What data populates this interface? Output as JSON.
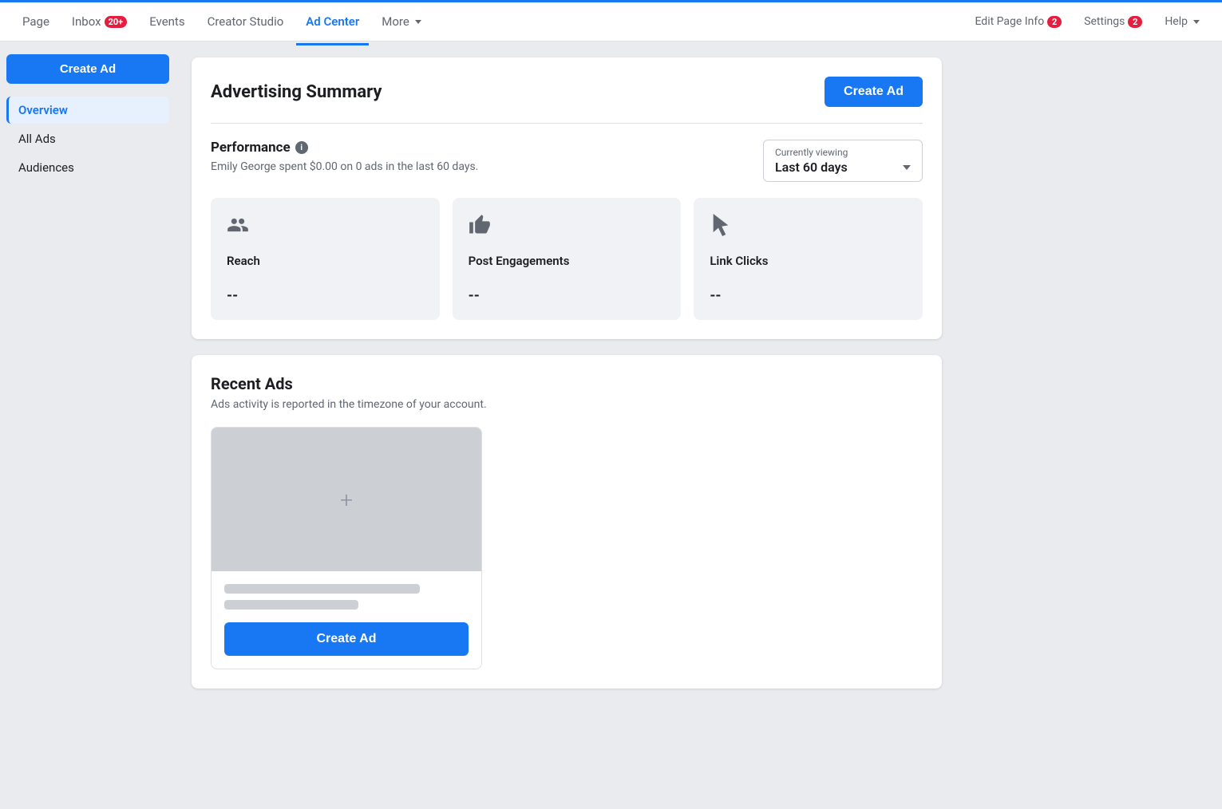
{
  "nav": {
    "items_left": [
      {
        "id": "page",
        "label": "Page",
        "active": false,
        "badge": null
      },
      {
        "id": "inbox",
        "label": "Inbox",
        "active": false,
        "badge": "20+"
      },
      {
        "id": "events",
        "label": "Events",
        "active": false,
        "badge": null
      },
      {
        "id": "creator-studio",
        "label": "Creator Studio",
        "active": false,
        "badge": null
      },
      {
        "id": "ad-center",
        "label": "Ad Center",
        "active": true,
        "badge": null
      },
      {
        "id": "more",
        "label": "More",
        "active": false,
        "badge": null,
        "dropdown": true
      }
    ],
    "items_right": [
      {
        "id": "edit-page-info",
        "label": "Edit Page Info",
        "badge": "2"
      },
      {
        "id": "settings",
        "label": "Settings",
        "badge": "2"
      },
      {
        "id": "help",
        "label": "Help",
        "dropdown": true
      }
    ]
  },
  "sidebar": {
    "create_button": "Create Ad",
    "nav_items": [
      {
        "id": "overview",
        "label": "Overview",
        "active": true
      },
      {
        "id": "all-ads",
        "label": "All Ads",
        "active": false
      },
      {
        "id": "audiences",
        "label": "Audiences",
        "active": false
      }
    ]
  },
  "advertising_summary": {
    "title": "Advertising Summary",
    "create_ad_button": "Create Ad",
    "performance": {
      "title": "Performance",
      "subtitle": "Emily George spent $0.00 on 0 ads in the last 60 days.",
      "viewing_label": "Currently viewing",
      "viewing_value": "Last 60 days"
    },
    "metrics": [
      {
        "id": "reach",
        "icon_type": "reach",
        "label": "Reach",
        "value": "--"
      },
      {
        "id": "post-engagements",
        "icon_type": "thumbsup",
        "label": "Post Engagements",
        "value": "--"
      },
      {
        "id": "link-clicks",
        "icon_type": "cursor",
        "label": "Link Clicks",
        "value": "--"
      }
    ]
  },
  "recent_ads": {
    "title": "Recent Ads",
    "subtitle": "Ads activity is reported in the timezone of your account.",
    "create_ad_button": "Create Ad"
  }
}
